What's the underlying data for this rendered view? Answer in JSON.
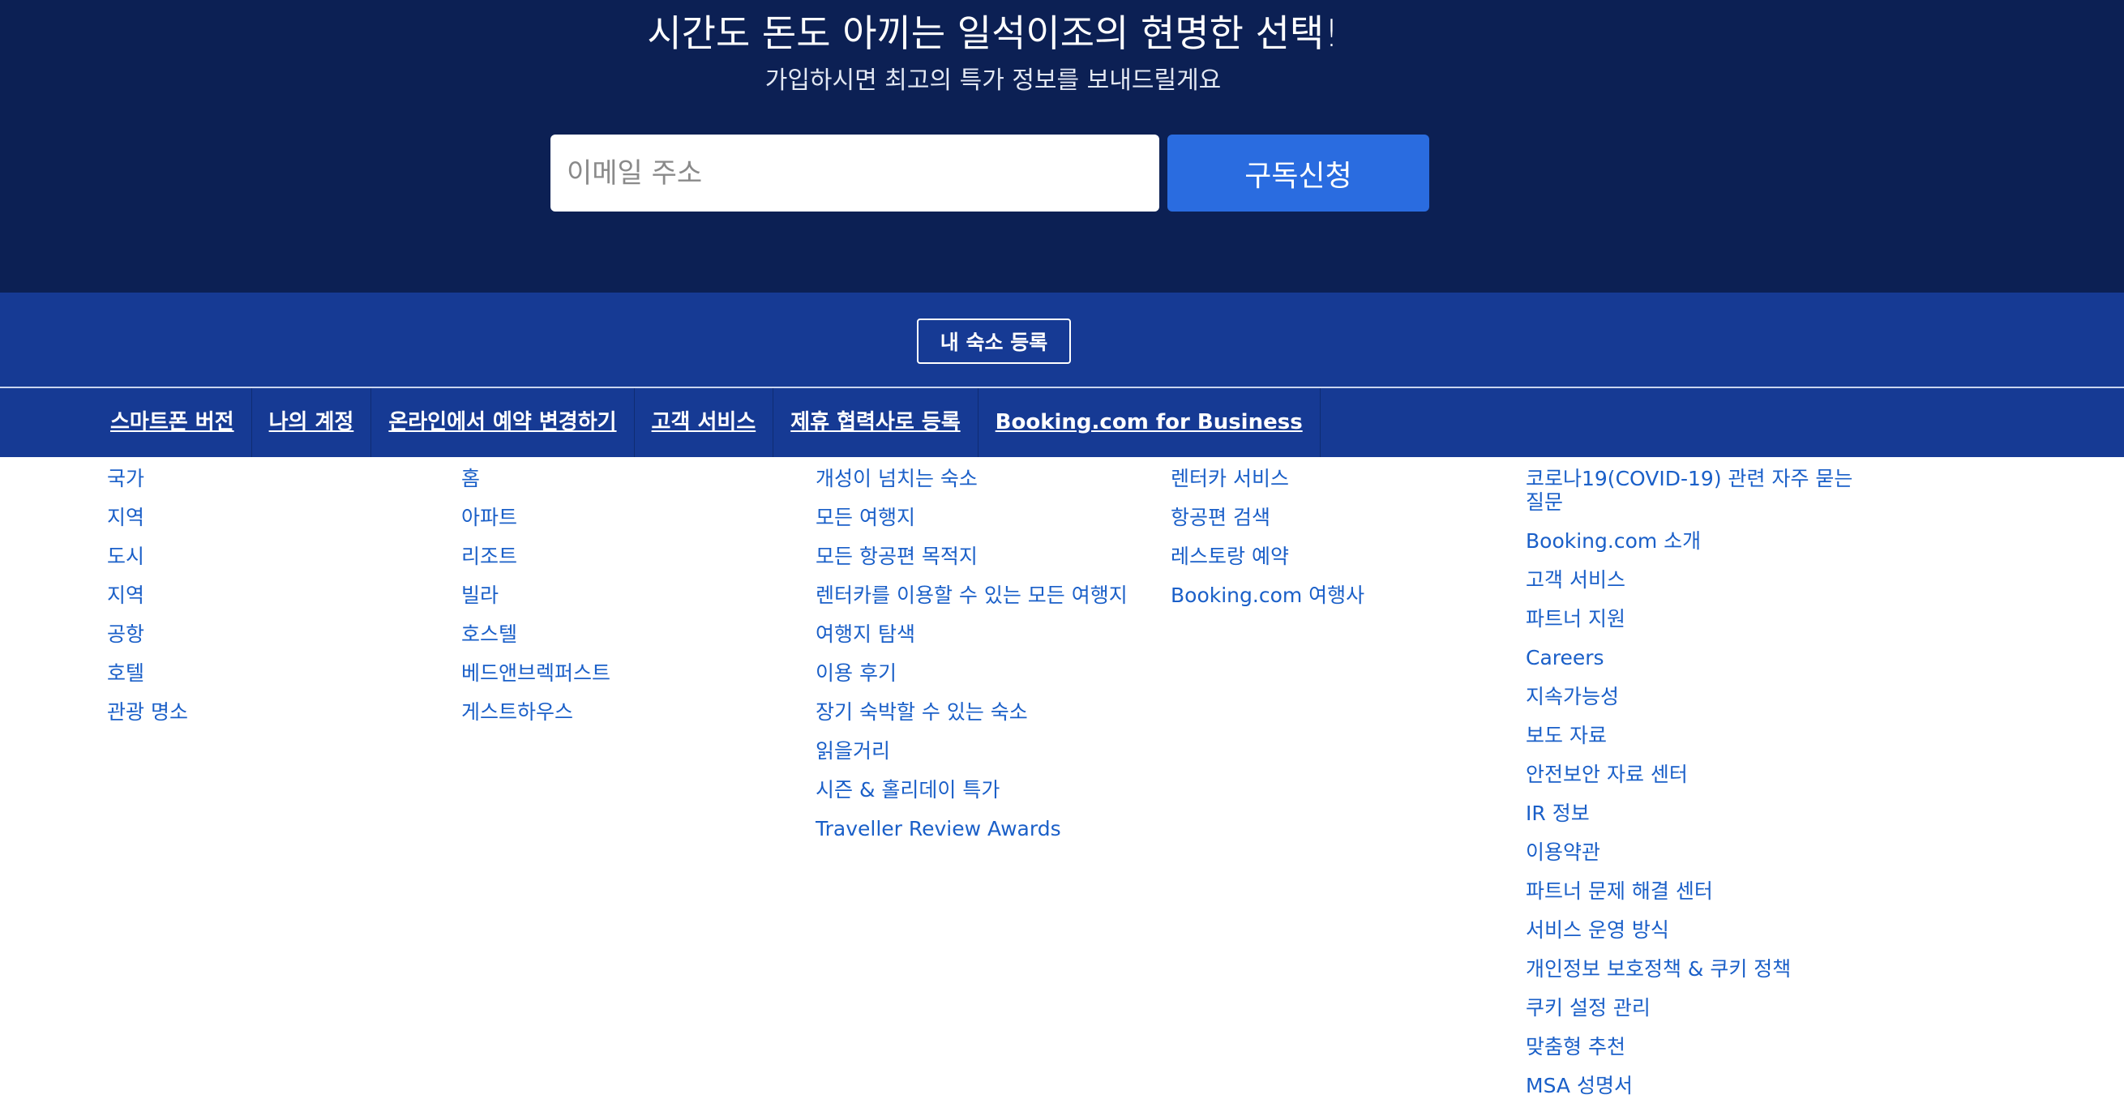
{
  "newsletter": {
    "title": "시간도 돈도 아끼는 일석이조의 현명한 선택!",
    "subtitle": "가입하시면 최고의 특가 정보를 보내드릴게요",
    "email_placeholder": "이메일 주소",
    "subscribe_label": "구독신청"
  },
  "register": {
    "label": "내 숙소 등록"
  },
  "nav": {
    "items": [
      {
        "label": "스마트폰 버전"
      },
      {
        "label": "나의 계정"
      },
      {
        "label": "온라인에서 예약 변경하기"
      },
      {
        "label": "고객 서비스"
      },
      {
        "label": "제휴 협력사로 등록"
      },
      {
        "label": "Booking.com for Business"
      }
    ]
  },
  "footer": {
    "col1": [
      "국가",
      "지역",
      "도시",
      "지역",
      "공항",
      "호텔",
      "관광 명소"
    ],
    "col2": [
      "홈",
      "아파트",
      "리조트",
      "빌라",
      "호스텔",
      "베드앤브렉퍼스트",
      "게스트하우스"
    ],
    "col3": [
      "개성이 넘치는 숙소",
      "모든 여행지",
      "모든 항공편 목적지",
      "렌터카를 이용할 수 있는 모든 여행지",
      "여행지 탐색",
      "이용 후기",
      "장기 숙박할 수 있는 숙소",
      "읽을거리",
      "시즌 & 홀리데이 특가",
      "Traveller Review Awards"
    ],
    "col4": [
      "렌터카 서비스",
      "항공편 검색",
      "레스토랑 예약",
      "Booking.com 여행사"
    ],
    "col5": [
      "코로나19(COVID-19) 관련 자주 묻는 질문",
      "Booking.com 소개",
      "고객 서비스",
      "파트너 지원",
      "Careers",
      "지속가능성",
      "보도 자료",
      "안전보안 자료 센터",
      "IR 정보",
      "이용약관",
      "파트너 문제 해결 센터",
      "서비스 운영 방식",
      "개인정보 보호정책 & 쿠키 정책",
      "쿠키 설정 관리",
      "맞춤형 추천",
      "MSA 성명서"
    ]
  }
}
